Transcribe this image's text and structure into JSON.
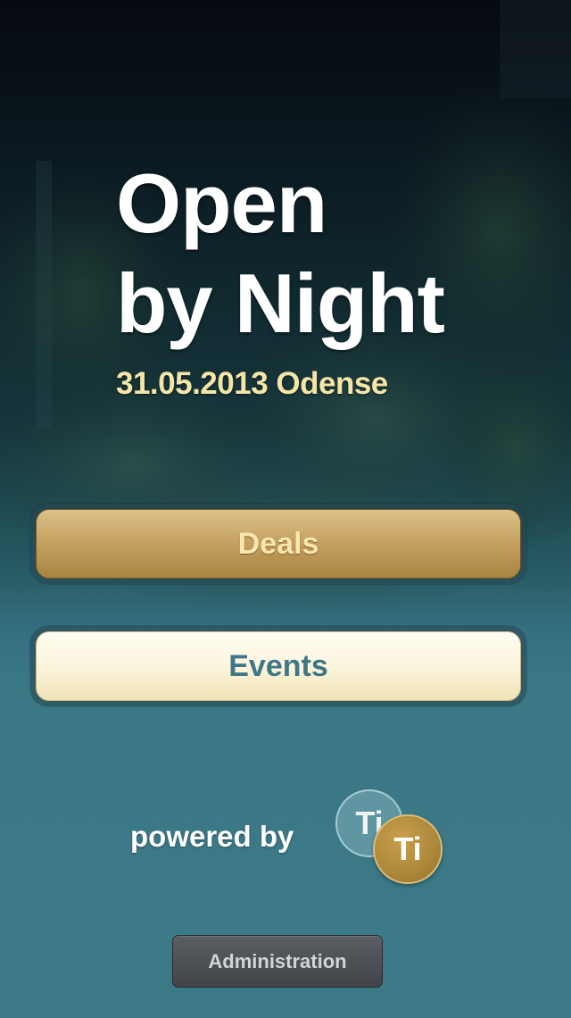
{
  "title": {
    "line1": "Open",
    "line2": "by Night"
  },
  "subtitle": "31.05.2013 Odense",
  "buttons": {
    "deals_label": "Deals",
    "events_label": "Events"
  },
  "footer": {
    "powered_by": "powered by",
    "logo_back_text": "Ti",
    "logo_front_text": "Ti",
    "admin_label": "Administration"
  },
  "colors": {
    "accent_gold": "#c6a364",
    "subtitle_cream": "#f5e6a8",
    "teal": "#3c7987"
  }
}
